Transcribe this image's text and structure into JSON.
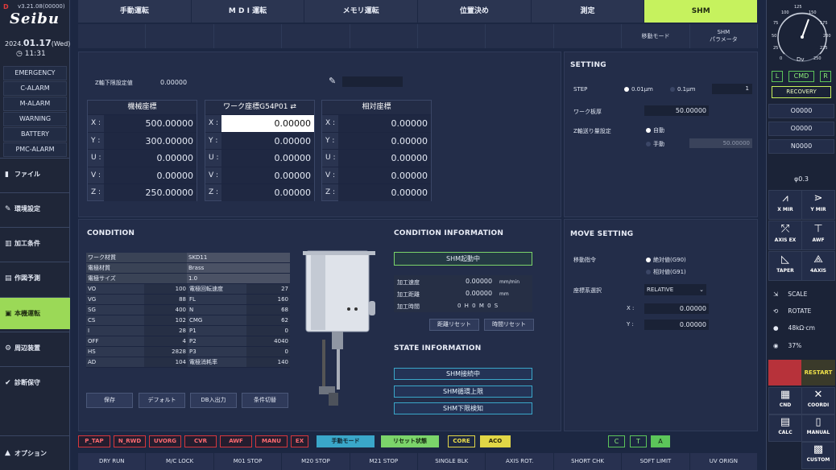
{
  "left": {
    "version": "v3.21.08(00000)",
    "brand": "Seibu",
    "date_prefix": "2024.",
    "date": "01.17",
    "weekday": "(Wed)",
    "time": "11:31",
    "alarms": [
      "EMERGENCY",
      "C-ALARM",
      "M-ALARM",
      "WARNING",
      "BATTERY",
      "PMC-ALARM"
    ],
    "nav": [
      "ファイル",
      "環境設定",
      "加工条件",
      "作図予測",
      "本機運転",
      "周辺装置",
      "診断保守"
    ],
    "options": "オプション"
  },
  "tabs": [
    "手動運転",
    "M D I 運転",
    "メモリ運転",
    "位置決め",
    "測定",
    "SHM"
  ],
  "subtabs": [
    "",
    "",
    "",
    "",
    "",
    "",
    "",
    "",
    "移動モード",
    "SHM\nパラメータ"
  ],
  "zaxis": {
    "label": "Z軸下限設定値",
    "value": "0.00000"
  },
  "coords": {
    "machine": {
      "title": "機械座標",
      "rows": [
        [
          "X :",
          "500.00000"
        ],
        [
          "Y :",
          "300.00000"
        ],
        [
          "U :",
          "0.00000"
        ],
        [
          "V :",
          "0.00000"
        ],
        [
          "Z :",
          "250.00000"
        ]
      ]
    },
    "work": {
      "title": "ワーク座標G54P01",
      "rows": [
        [
          "X :",
          "0.00000"
        ],
        [
          "Y :",
          "0.00000"
        ],
        [
          "U :",
          "0.00000"
        ],
        [
          "V :",
          "0.00000"
        ],
        [
          "Z :",
          "0.00000"
        ]
      ]
    },
    "relative": {
      "title": "相対座標",
      "rows": [
        [
          "X :",
          "0.00000"
        ],
        [
          "Y :",
          "0.00000"
        ],
        [
          "U :",
          "0.00000"
        ],
        [
          "V :",
          "0.00000"
        ],
        [
          "Z :",
          "0.00000"
        ]
      ]
    }
  },
  "setting": {
    "title": "SETTING",
    "step_label": "STEP",
    "step_opt1": "0.01μm",
    "step_opt2": "0.1μm",
    "step_value": "1",
    "work_thickness_label": "ワーク板厚",
    "work_thickness": "50.00000",
    "zfeed_label": "Z軸送り量設定",
    "zfeed_auto": "自動",
    "zfeed_manual": "手動",
    "zfeed_value": "50.00000"
  },
  "condition": {
    "title": "CONDITION",
    "material_label": "ワーク材質",
    "material": "SKD11",
    "electrode_label": "電極材質",
    "electrode": "Brass",
    "size_label": "電極サイズ",
    "size": "1.0",
    "rows": [
      [
        "VO",
        "100",
        "電極回転速度",
        "27"
      ],
      [
        "VG",
        "88",
        "FL",
        "160"
      ],
      [
        "SG",
        "400",
        "N",
        "68"
      ],
      [
        "CS",
        "102",
        "CMG",
        "62"
      ],
      [
        "I",
        "28",
        "P1",
        "0"
      ],
      [
        "OFF",
        "4",
        "P2",
        "4040"
      ],
      [
        "HS",
        "2828",
        "P3",
        "0"
      ],
      [
        "AD",
        "104",
        "電極消耗率",
        "140"
      ]
    ],
    "buttons": [
      "保存",
      "デフォルト",
      "DB入出力",
      "条件切替"
    ]
  },
  "cond_info": {
    "title": "CONDITION INFORMATION",
    "status": "SHM起動中",
    "speed_label": "加工速度",
    "speed": "0.00000",
    "speed_unit": "mm/min",
    "dist_label": "加工距離",
    "dist": "0.00000",
    "dist_unit": "mm",
    "time_label": "加工時間",
    "time": "0 H  0 M  0 S",
    "reset_dist": "距離リセット",
    "reset_time": "時間リセット"
  },
  "state_info": {
    "title": "STATE INFORMATION",
    "items": [
      "SHM接続中",
      "SHM循環上限",
      "SHM下限検知"
    ]
  },
  "move": {
    "title": "MOVE SETTING",
    "cmd_label": "移動指令",
    "abs": "絶対値(G90)",
    "rel": "相対値(G91)",
    "coord_label": "座標系選択",
    "coord_select": "RELATIVE",
    "x_label": "X :",
    "x": "0.00000",
    "y_label": "Y :",
    "y": "0.00000"
  },
  "right": {
    "gauge_unit": "Dv",
    "gauge_ticks": [
      "0",
      "25",
      "50",
      "75",
      "100",
      "125",
      "150",
      "175",
      "200",
      "225",
      "250"
    ],
    "lcr": [
      "L",
      "CMD",
      "R"
    ],
    "recovery": "RECOVERY",
    "o1": "O0000",
    "o2": "O0000",
    "n": "N0000",
    "phi": "φ0.3",
    "buttons": [
      "X MIR",
      "Y MIR",
      "AXIS EX",
      "AWF",
      "TAPER",
      "4AXIS"
    ],
    "scale": "SCALE",
    "rotate": "ROTATE",
    "resist": "48kΩ·cm",
    "percent": "37%",
    "restart": "RESTART",
    "cnd": "CND",
    "coordi": "COORDI",
    "calc": "CALC",
    "manual": "MANUAL",
    "custom": "CUSTOM"
  },
  "status_bar": {
    "red": [
      "P_TAP",
      "N_RWD",
      "UVORG",
      "CVR",
      "AWF",
      "MANU",
      "EX"
    ],
    "mode": "手動モード",
    "reset": "リセット状態",
    "core": "CORE",
    "aco": "ACO",
    "green": [
      "C",
      "T",
      "A"
    ]
  },
  "bottom": [
    "DRY RUN",
    "M/C LOCK",
    "M01 STOP",
    "M20 STOP",
    "M21 STOP",
    "SINGLE BLK",
    "AXIS ROT.",
    "SHORT CHK",
    "SOFT LIMIT",
    "UV ORIGN"
  ],
  "colors": {
    "accent": "#c6f25e",
    "nav_active": "#9bd957",
    "alarm_red": "#d7363c",
    "info_cyan": "#3aa7c9"
  }
}
